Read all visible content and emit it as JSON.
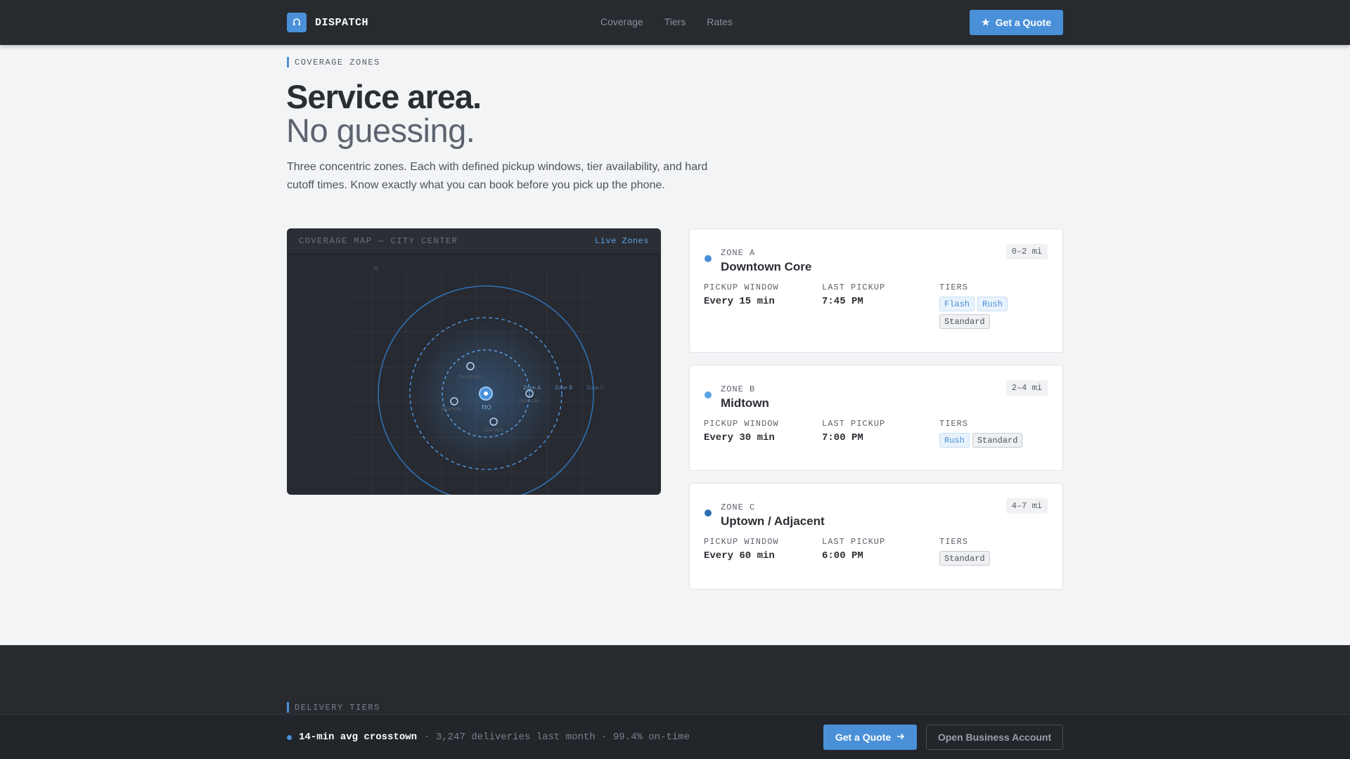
{
  "header": {
    "brand": "DISPATCH",
    "nav": [
      "Coverage",
      "Tiers",
      "Rates"
    ],
    "cta": "Get a Quote"
  },
  "hero": {
    "eyebrow": "COVERAGE ZONES",
    "title": "Service area.",
    "subtitle": "No guessing.",
    "lede": "Three concentric zones. Each with defined pickup windows, tier availability, and hard cutoff times. Know exactly what you can book before you pick up the phone."
  },
  "map": {
    "title": "COVERAGE MAP — CITY CENTER",
    "live": "Live Zones",
    "compass": "N",
    "hq": "HQ",
    "ring_labels": [
      "Zone A",
      "Zone B",
      "Zone C"
    ],
    "place_labels": [
      "Downtown",
      "Financial",
      "Riverside",
      "Arts Dist."
    ]
  },
  "zones": [
    {
      "label": "ZONE A",
      "name": "Downtown Core",
      "distance": "0–2 mi",
      "color": "#4a90d9",
      "pickup_window": "Every 15 min",
      "last_pickup": "7:45 PM",
      "tiers": [
        "Flash",
        "Rush",
        "Standard"
      ]
    },
    {
      "label": "ZONE B",
      "name": "Midtown",
      "distance": "2–4 mi",
      "color": "#5aa2e6",
      "pickup_window": "Every 30 min",
      "last_pickup": "7:00 PM",
      "tiers": [
        "Rush",
        "Standard"
      ]
    },
    {
      "label": "ZONE C",
      "name": "Uptown / Adjacent",
      "distance": "4–7 mi",
      "color": "#2d6fb3",
      "pickup_window": "Every 60 min",
      "last_pickup": "6:00 PM",
      "tiers": [
        "Standard"
      ]
    }
  ],
  "columns": {
    "pickup": "PICKUP WINDOW",
    "last": "LAST PICKUP",
    "tiers": "TIERS"
  },
  "section2": {
    "eyebrow": "DELIVERY TIERS"
  },
  "sticky": {
    "headline": "14-min avg crosstown",
    "details": "· 3,247 deliveries last month · 99.4% on-time",
    "cta": "Get a Quote",
    "secondary": "Open Business Account"
  }
}
